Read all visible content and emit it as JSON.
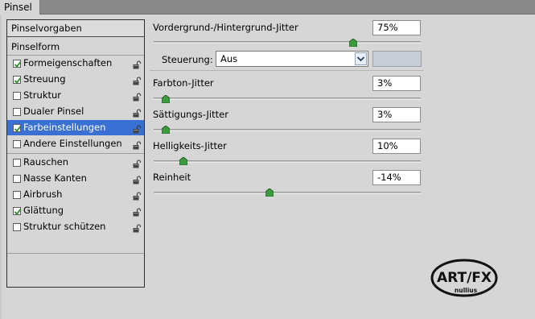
{
  "window": {
    "tab_title": "Pinsel"
  },
  "left_panel": {
    "presets_label": "Pinselvorgaben",
    "section_label": "Pinselform",
    "items": [
      {
        "label": "Formeigenschaften",
        "checked": true,
        "selected": false
      },
      {
        "label": "Streuung",
        "checked": true,
        "selected": false
      },
      {
        "label": "Struktur",
        "checked": false,
        "selected": false
      },
      {
        "label": "Dualer Pinsel",
        "checked": false,
        "selected": false
      },
      {
        "label": "Farbeinstellungen",
        "checked": true,
        "selected": true
      },
      {
        "label": "Andere Einstellungen",
        "checked": false,
        "selected": false
      },
      {
        "label": "Rauschen",
        "checked": false,
        "selected": false
      },
      {
        "label": "Nasse Kanten",
        "checked": false,
        "selected": false
      },
      {
        "label": "Airbrush",
        "checked": false,
        "selected": false
      },
      {
        "label": "Glättung",
        "checked": true,
        "selected": false
      },
      {
        "label": "Struktur schützen",
        "checked": false,
        "selected": false
      }
    ]
  },
  "settings": {
    "fg_bg_jitter": {
      "label": "Vordergrund-/Hintergrund-Jitter",
      "value": "75%",
      "level": 0.75
    },
    "control": {
      "label": "Steuerung:",
      "value": "Aus"
    },
    "hue_jitter": {
      "label": "Farbton-Jitter",
      "value": "3%",
      "level": 0.03
    },
    "saturation_jitter": {
      "label": "Sättigungs-Jitter",
      "value": "3%",
      "level": 0.03
    },
    "brightness_jitter": {
      "label": "Helligkeits-Jitter",
      "value": "10%",
      "level": 0.1
    },
    "purity": {
      "label": "Reinheit",
      "value": "-14%",
      "level": -0.14,
      "range": [
        -1,
        1
      ]
    }
  },
  "logo": {
    "text_main": "ART/FX",
    "text_sub": "nullius"
  },
  "colors": {
    "selection": "#3a6fd3",
    "check": "#2e8b2e",
    "thumb": "#3e9a3e"
  }
}
